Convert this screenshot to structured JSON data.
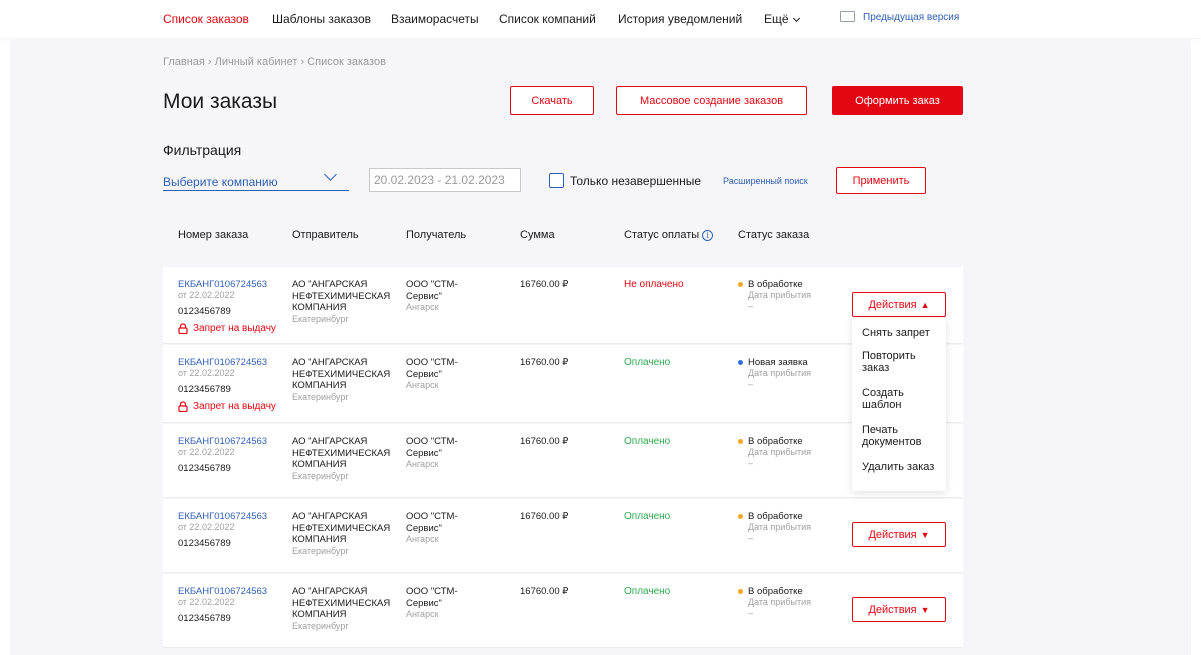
{
  "nav": {
    "items": [
      {
        "label": "Список заказов",
        "active": true
      },
      {
        "label": "Шаблоны заказов"
      },
      {
        "label": "Взаиморасчеты"
      },
      {
        "label": "Список компаний"
      },
      {
        "label": "История уведомлений"
      },
      {
        "label": "Ещё"
      }
    ],
    "prev_version": "Предыдущая версия"
  },
  "breadcrumb": "Главная › Личный кабинет › Список заказов",
  "page_title": "Мои заказы",
  "buttons": {
    "download": "Скачать",
    "bulk_create": "Массовое создание заказов",
    "create_order": "Оформить заказ",
    "apply": "Применить"
  },
  "filters": {
    "title": "Фильтрация",
    "company_placeholder": "Выберите компанию",
    "date_range": "20.02.2023 - 21.02.2023",
    "only_unfinished": "Только незавершенные",
    "advanced_search": "Расширенный поиск"
  },
  "table": {
    "headers": {
      "order_number": "Номер заказа",
      "sender": "Отправитель",
      "recipient": "Получатель",
      "sum": "Сумма",
      "payment_status": "Статус оплаты",
      "order_status": "Статус заказа"
    },
    "rows": [
      {
        "order_link": "ЕКБАНГ0106724563",
        "date": "от 22.02.2022",
        "code": "0123456789",
        "ban": "Запрет на выдачу",
        "sender": "АО \"АНГАРСКАЯ НЕФТЕХИМИЧЕСКАЯ КОМПАНИЯ",
        "sender_city": "Екатеринбург",
        "recipient": "ООО \"СТМ-Сервис\"",
        "recipient_city": "Ангарск",
        "sum": "16760.00 ₽",
        "payment": "Не оплачено",
        "status": "В обработке",
        "arrival_label": "Дата прибытия",
        "arrival": "–",
        "actions": "Действия"
      },
      {
        "order_link": "ЕКБАНГ0106724563",
        "date": "от 22.02.2022",
        "code": "0123456789",
        "ban": "Запрет на выдачу",
        "sender": "АО \"АНГАРСКАЯ НЕФТЕХИМИЧЕСКАЯ КОМПАНИЯ",
        "sender_city": "Екатеринбург",
        "recipient": "ООО \"СТМ-Сервис\"",
        "recipient_city": "Ангарск",
        "sum": "16760.00 ₽",
        "payment": "Оплачено",
        "status": "Новая заявка",
        "arrival_label": "Дата прибытия",
        "arrival": "–"
      },
      {
        "order_link": "ЕКБАНГ0106724563",
        "date": "от 22.02.2022",
        "code": "0123456789",
        "sender": "АО \"АНГАРСКАЯ НЕФТЕХИМИЧЕСКАЯ КОМПАНИЯ",
        "sender_city": "Екатеринбург",
        "recipient": "ООО \"СТМ-Сервис\"",
        "recipient_city": "Ангарск",
        "sum": "16760.00 ₽",
        "payment": "Оплачено",
        "status": "В обработке",
        "arrival_label": "Дата прибытия",
        "arrival": "–"
      },
      {
        "order_link": "ЕКБАНГ0106724563",
        "date": "от 22.02.2022",
        "code": "0123456789",
        "sender": "АО \"АНГАРСКАЯ НЕФТЕХИМИЧЕСКАЯ КОМПАНИЯ",
        "sender_city": "Екатеринбург",
        "recipient": "ООО \"СТМ-Сервис\"",
        "recipient_city": "Ангарск",
        "sum": "16760.00 ₽",
        "payment": "Оплачено",
        "status": "В обработке",
        "arrival_label": "Дата прибытия",
        "arrival": "–",
        "actions": "Действия"
      },
      {
        "order_link": "ЕКБАНГ0106724563",
        "date": "от 22.02.2022",
        "code": "0123456789",
        "sender": "АО \"АНГАРСКАЯ НЕФТЕХИМИЧЕСКАЯ КОМПАНИЯ",
        "sender_city": "Екатеринбург",
        "recipient": "ООО \"СТМ-Сервис\"",
        "recipient_city": "Ангарск",
        "sum": "16760.00 ₽",
        "payment": "Оплачено",
        "status": "В обработке",
        "arrival_label": "Дата прибытия",
        "arrival": "–",
        "actions": "Действия"
      }
    ]
  },
  "actions_menu": [
    "Снять запрет",
    "Повторить заказ",
    "Создать шаблон",
    "Печать документов",
    "Удалить заказ"
  ],
  "colors": {
    "accent": "#e30613",
    "link": "#2f5fb3",
    "paid": "#2fa84f",
    "status_processing": "#f5a623",
    "status_new": "#2f6fe0"
  },
  "icons": {
    "ban": "lock-icon",
    "info": "info-icon",
    "more": "chevron-down-icon"
  }
}
